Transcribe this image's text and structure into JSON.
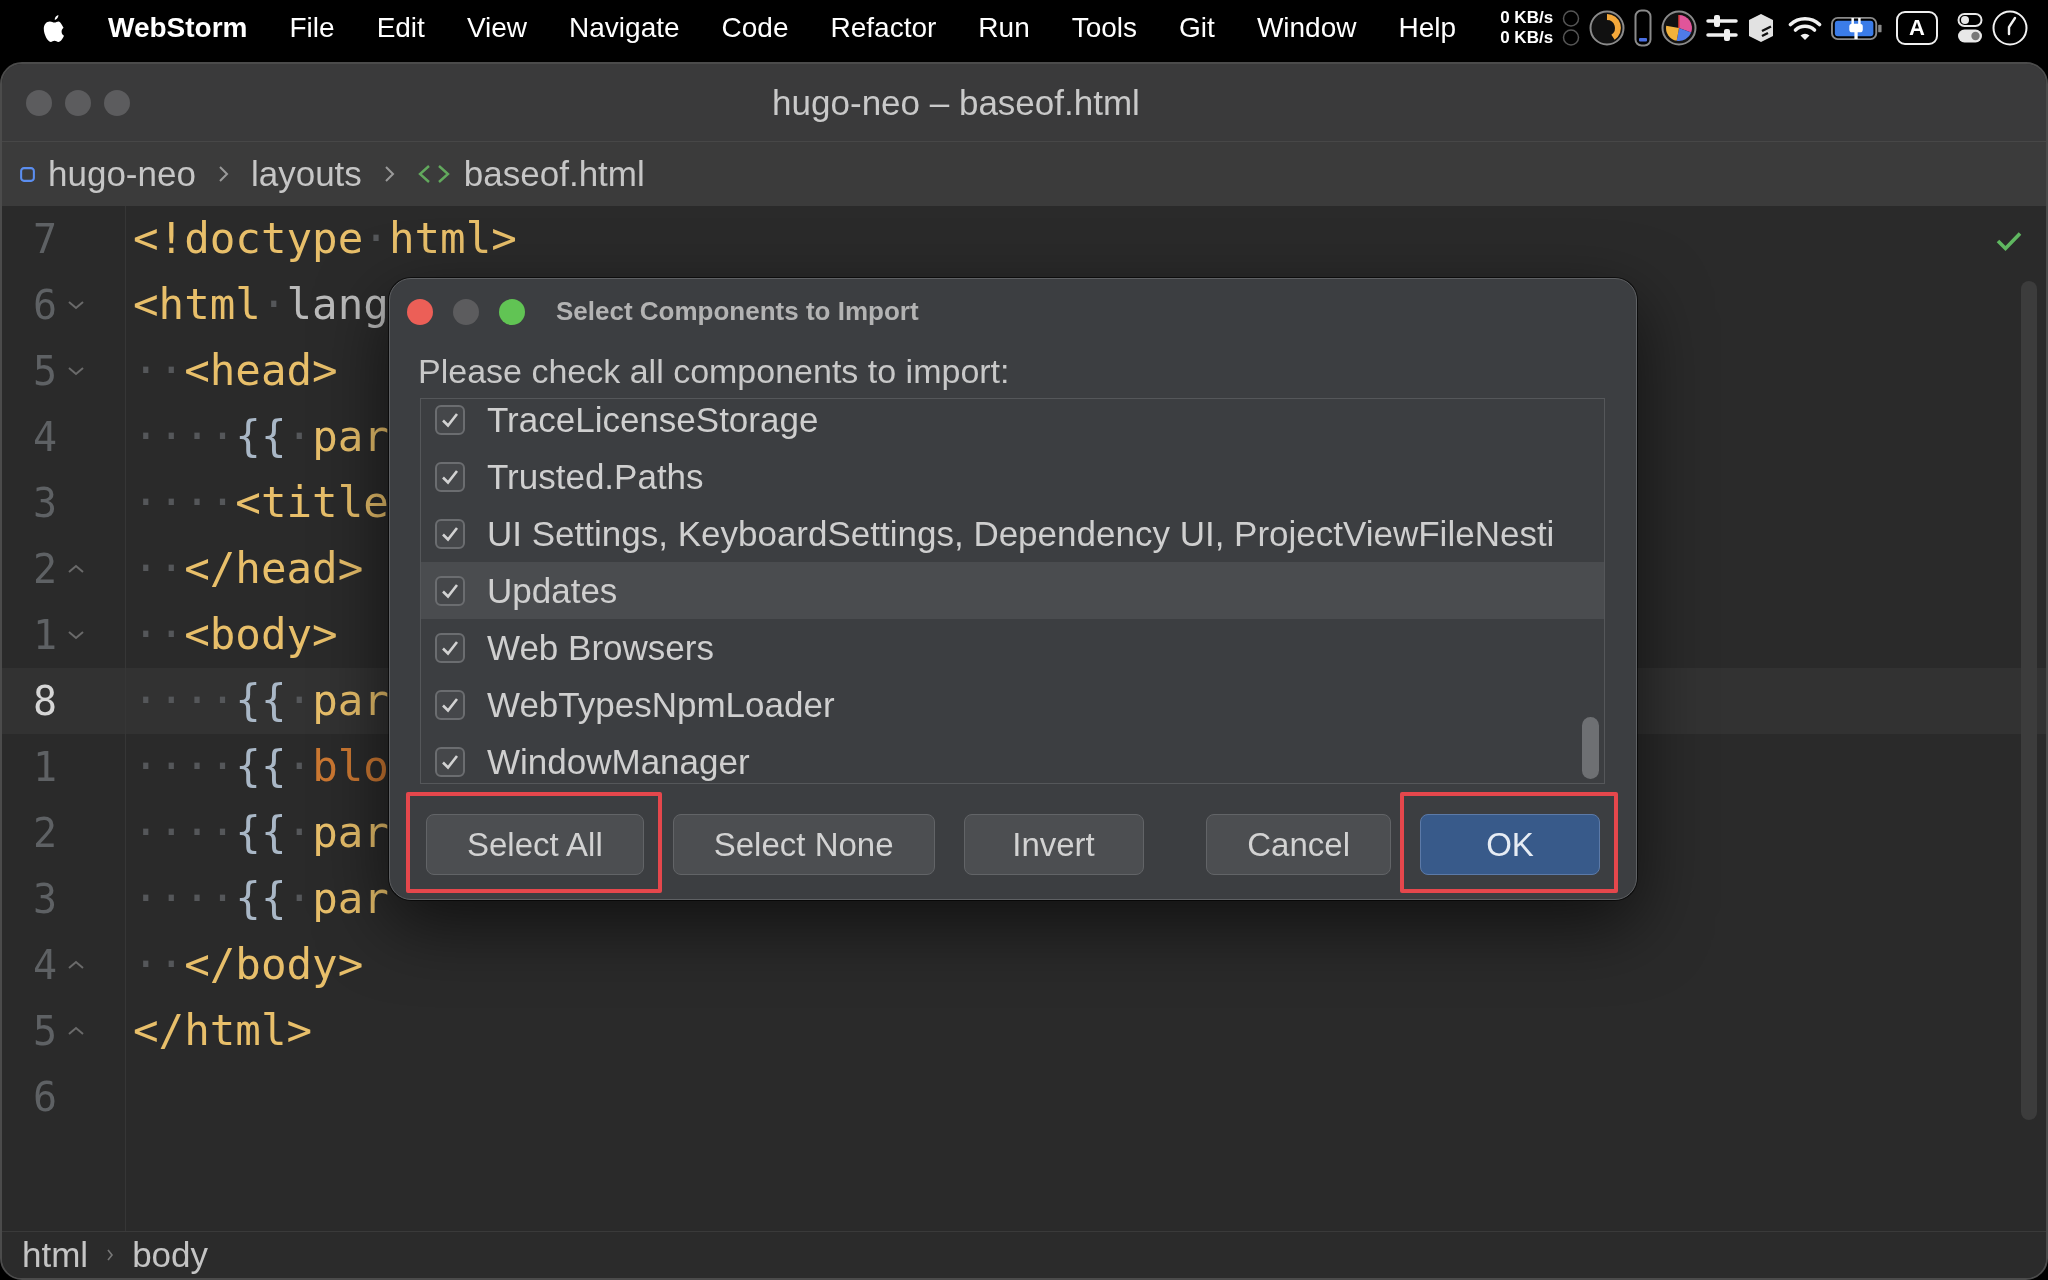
{
  "menu_bar": {
    "app_name": "WebStorm",
    "menus": [
      "File",
      "Edit",
      "View",
      "Navigate",
      "Code",
      "Refactor",
      "Run",
      "Tools",
      "Git",
      "Window",
      "Help"
    ],
    "network_speeds": [
      "0 KB/s",
      "0 KB/s"
    ],
    "input_source": "A"
  },
  "window": {
    "title": "hugo-neo – baseof.html",
    "active": false
  },
  "breadcrumbs": [
    {
      "label": "hugo-neo",
      "kind": "project"
    },
    {
      "label": "layouts",
      "kind": "folder"
    },
    {
      "label": "baseof.html",
      "kind": "file"
    }
  ],
  "editor": {
    "lines": [
      {
        "number": "7",
        "kind": "plain",
        "current": false,
        "tokens": [
          {
            "kind": "tag",
            "text": "<!doctype"
          },
          {
            "kind": "whitespace",
            "text": "·"
          },
          {
            "kind": "tag",
            "text": "html>"
          }
        ]
      },
      {
        "number": "6",
        "kind": "fold-start",
        "current": false,
        "tokens": [
          {
            "kind": "tag",
            "text": "<html"
          },
          {
            "kind": "whitespace",
            "text": "·"
          },
          {
            "kind": "attribute",
            "text": "lang"
          }
        ]
      },
      {
        "number": "5",
        "kind": "fold-start",
        "current": false,
        "tokens": [
          {
            "kind": "whitespace",
            "text": "··"
          },
          {
            "kind": "tag",
            "text": "<head>"
          }
        ]
      },
      {
        "number": "4",
        "kind": "plain",
        "current": false,
        "tokens": [
          {
            "kind": "whitespace",
            "text": "····"
          },
          {
            "kind": "brace",
            "text": "{{"
          },
          {
            "kind": "whitespace",
            "text": "·"
          },
          {
            "kind": "function",
            "text": "par"
          }
        ]
      },
      {
        "number": "3",
        "kind": "plain",
        "current": false,
        "tokens": [
          {
            "kind": "whitespace",
            "text": "····"
          },
          {
            "kind": "tag",
            "text": "<title"
          }
        ]
      },
      {
        "number": "2",
        "kind": "fold-end",
        "current": false,
        "tokens": [
          {
            "kind": "whitespace",
            "text": "··"
          },
          {
            "kind": "tag",
            "text": "</head>"
          }
        ]
      },
      {
        "number": "1",
        "kind": "fold-start",
        "current": false,
        "tokens": [
          {
            "kind": "whitespace",
            "text": "··"
          },
          {
            "kind": "tag",
            "text": "<body>"
          }
        ]
      },
      {
        "number": "8",
        "kind": "plain",
        "current": true,
        "tokens": [
          {
            "kind": "whitespace",
            "text": "····"
          },
          {
            "kind": "brace",
            "text": "{{"
          },
          {
            "kind": "whitespace",
            "text": "·"
          },
          {
            "kind": "function",
            "text": "par"
          }
        ]
      },
      {
        "number": "1",
        "kind": "plain",
        "current": false,
        "tokens": [
          {
            "kind": "whitespace",
            "text": "····"
          },
          {
            "kind": "brace",
            "text": "{{"
          },
          {
            "kind": "whitespace",
            "text": "·"
          },
          {
            "kind": "keyword",
            "text": "blo"
          }
        ]
      },
      {
        "number": "2",
        "kind": "plain",
        "current": false,
        "tokens": [
          {
            "kind": "whitespace",
            "text": "····"
          },
          {
            "kind": "brace",
            "text": "{{"
          },
          {
            "kind": "whitespace",
            "text": "·"
          },
          {
            "kind": "function",
            "text": "par"
          }
        ]
      },
      {
        "number": "3",
        "kind": "plain",
        "current": false,
        "tokens": [
          {
            "kind": "whitespace",
            "text": "····"
          },
          {
            "kind": "brace",
            "text": "{{"
          },
          {
            "kind": "whitespace",
            "text": "·"
          },
          {
            "kind": "function",
            "text": "par"
          }
        ]
      },
      {
        "number": "4",
        "kind": "fold-end",
        "current": false,
        "tokens": [
          {
            "kind": "whitespace",
            "text": "··"
          },
          {
            "kind": "tag",
            "text": "</body>"
          }
        ]
      },
      {
        "number": "5",
        "kind": "fold-end",
        "current": false,
        "tokens": [
          {
            "kind": "tag",
            "text": "</html>"
          }
        ]
      },
      {
        "number": "6",
        "kind": "plain",
        "current": false
      }
    ]
  },
  "status_bar": {
    "path": [
      "html",
      "body"
    ]
  },
  "dialog": {
    "title": "Select Components to Import",
    "window_controls": [
      {
        "kind": "close",
        "disabled": false
      },
      {
        "kind": "minimize",
        "disabled": true
      },
      {
        "kind": "zoom",
        "disabled": false
      }
    ],
    "prompt": "Please check all components to import:",
    "components": [
      {
        "label": "TraceLicenseStorage",
        "checked": true,
        "selected": false
      },
      {
        "label": "Trusted.Paths",
        "checked": true,
        "selected": false
      },
      {
        "label": "UI Settings, KeyboardSettings, Dependency UI, ProjectViewFileNesti",
        "checked": true,
        "selected": false
      },
      {
        "label": "Updates",
        "checked": true,
        "selected": true
      },
      {
        "label": "Web Browsers",
        "checked": true,
        "selected": false
      },
      {
        "label": "WebTypesNpmLoader",
        "checked": true,
        "selected": false
      },
      {
        "label": "WindowManager",
        "checked": true,
        "selected": false
      }
    ],
    "button_groups": [
      {
        "buttons": [
          {
            "label": "Select All",
            "kind": "normal",
            "annotated": true
          },
          {
            "label": "Select None",
            "kind": "normal",
            "annotated": false
          },
          {
            "label": "Invert",
            "kind": "normal",
            "annotated": false
          }
        ]
      },
      {
        "buttons": [
          {
            "label": "Cancel",
            "kind": "normal",
            "annotated": false
          },
          {
            "label": "OK",
            "kind": "primary",
            "annotated": true
          }
        ]
      }
    ]
  }
}
